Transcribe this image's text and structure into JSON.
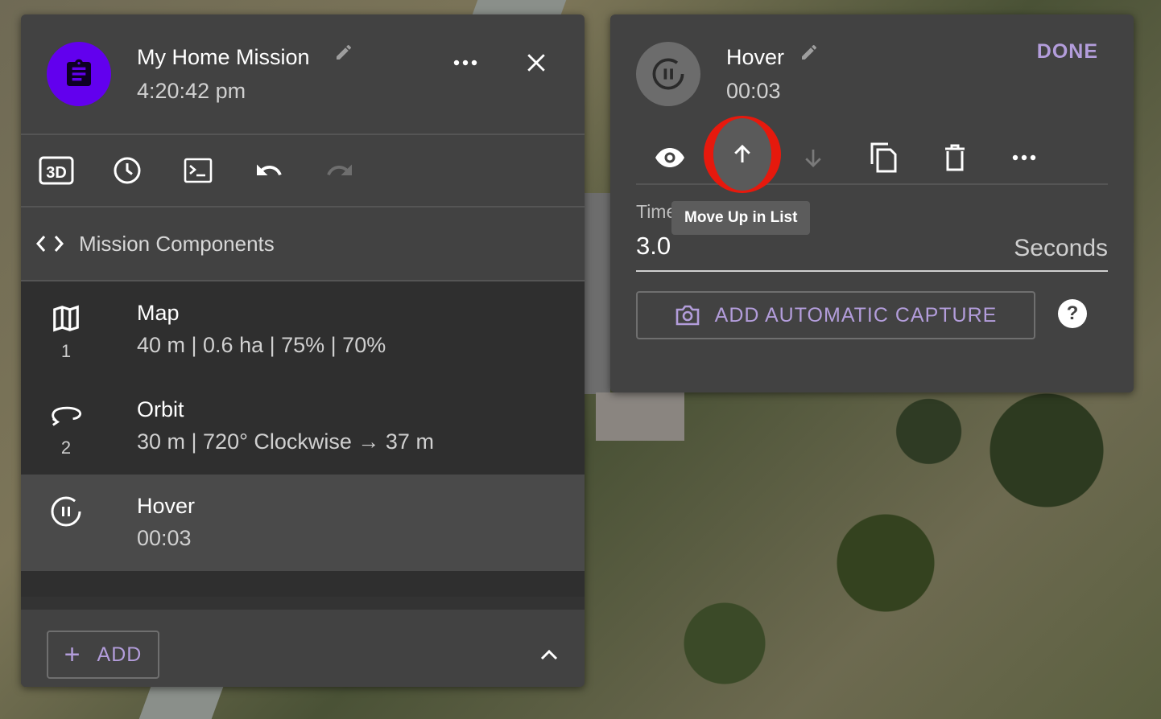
{
  "mission": {
    "title": "My Home Mission",
    "time": "4:20:42 pm"
  },
  "toolbar": {
    "icons": [
      "3d-view-icon",
      "clock-icon",
      "terminal-icon",
      "undo-icon",
      "redo-icon"
    ]
  },
  "section": {
    "label": "Mission Components"
  },
  "components": [
    {
      "name": "Map",
      "detail": "40 m | 0.6 ha | 75% | 70%",
      "index": "1",
      "icon": "map-icon"
    },
    {
      "name": "Orbit",
      "detail": "30 m | 720° Clockwise → 37 m",
      "index": "2",
      "icon": "orbit-icon"
    },
    {
      "name": "Hover",
      "detail": "00:03",
      "index": "",
      "icon": "hover-timer-icon",
      "selected": true
    }
  ],
  "footer": {
    "add_label": "ADD"
  },
  "editor": {
    "title": "Hover",
    "subtitle": "00:03",
    "done_label": "DONE",
    "tooltip": "Move Up in List",
    "field_label": "Time *",
    "field_value": "3.0",
    "field_unit": "Seconds",
    "capture_label": "ADD AUTOMATIC CAPTURE",
    "help_label": "?"
  },
  "colors": {
    "accent": "#6200ee",
    "link": "#b39ddb",
    "highlight_ring": "#e6190d",
    "panel": "#424242"
  }
}
